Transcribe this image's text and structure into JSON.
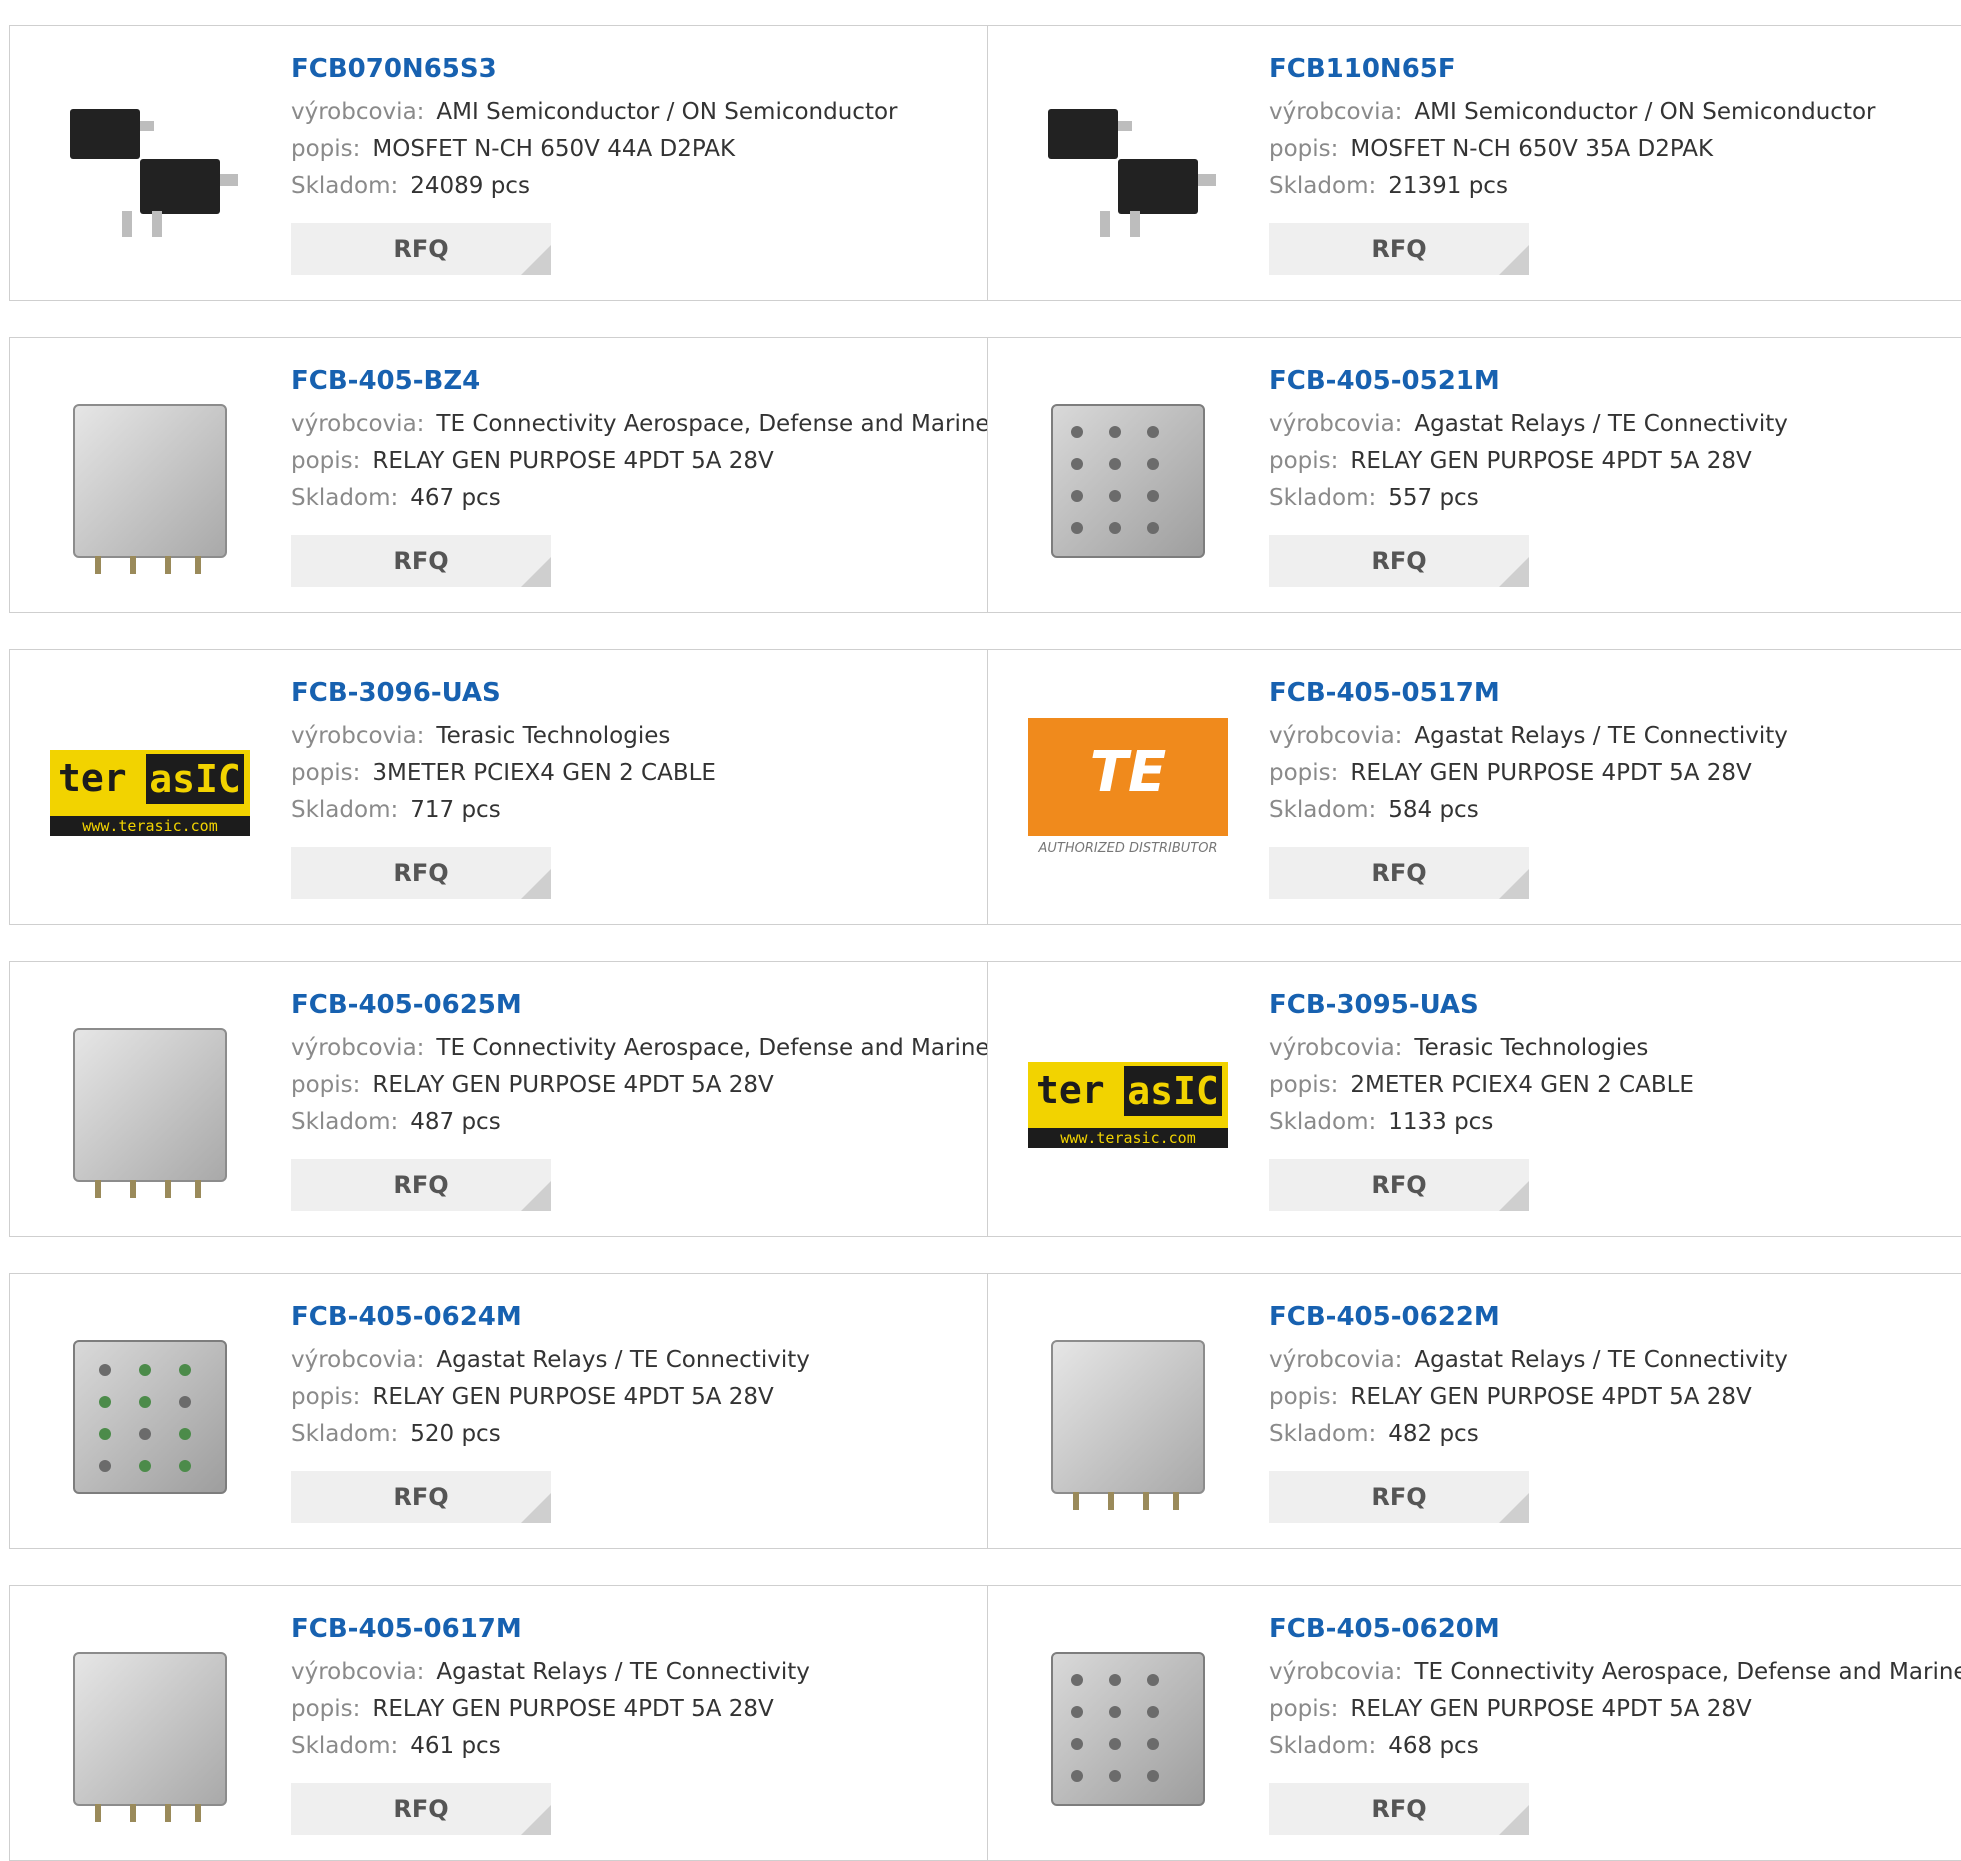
{
  "labels": {
    "manufacturer": "výrobcovia:",
    "description": "popis:",
    "stock": "Skladom:",
    "rfq": "RFQ"
  },
  "colors": {
    "title": "#1761b0",
    "label": "#8a8a8a",
    "value": "#333333",
    "border": "#cfcfcf",
    "rfq_bg": "#efefef"
  },
  "products": [
    {
      "part": "FCB070N65S3",
      "manufacturer": "AMI Semiconductor / ON Semiconductor",
      "description": "MOSFET N-CH 650V 44A D2PAK",
      "stock": "24089 pcs",
      "icon": "mosfet-d2pak-icon"
    },
    {
      "part": "FCB110N65F",
      "manufacturer": "AMI Semiconductor / ON Semiconductor",
      "description": "MOSFET N-CH 650V 35A D2PAK",
      "stock": "21391 pcs",
      "icon": "mosfet-d2pak-icon"
    },
    {
      "part": "FCB-405-BZ4",
      "manufacturer": "TE Connectivity Aerospace, Defense and Marine",
      "description": "RELAY GEN PURPOSE 4PDT 5A 28V",
      "stock": "467 pcs",
      "icon": "relay-icon"
    },
    {
      "part": "FCB-405-0521M",
      "manufacturer": "Agastat Relays / TE Connectivity",
      "description": "RELAY GEN PURPOSE 4PDT 5A 28V",
      "stock": "557 pcs",
      "icon": "relay-pins-icon"
    },
    {
      "part": "FCB-3096-UAS",
      "manufacturer": "Terasic Technologies",
      "description": "3METER PCIEX4 GEN 2 CABLE",
      "stock": "717 pcs",
      "icon": "terasic-logo"
    },
    {
      "part": "FCB-405-0517M",
      "manufacturer": "Agastat Relays / TE Connectivity",
      "description": "RELAY GEN PURPOSE 4PDT 5A 28V",
      "stock": "584 pcs",
      "icon": "te-connectivity-logo"
    },
    {
      "part": "FCB-405-0625M",
      "manufacturer": "TE Connectivity Aerospace, Defense and Marine",
      "description": "RELAY GEN PURPOSE 4PDT 5A 28V",
      "stock": "487 pcs",
      "icon": "relay-icon"
    },
    {
      "part": "FCB-3095-UAS",
      "manufacturer": "Terasic Technologies",
      "description": "2METER PCIEX4 GEN 2 CABLE",
      "stock": "1133 pcs",
      "icon": "terasic-logo"
    },
    {
      "part": "FCB-405-0624M",
      "manufacturer": "Agastat Relays / TE Connectivity",
      "description": "RELAY GEN PURPOSE 4PDT 5A 28V",
      "stock": "520 pcs",
      "icon": "relay-front-icon"
    },
    {
      "part": "FCB-405-0622M",
      "manufacturer": "Agastat Relays / TE Connectivity",
      "description": "RELAY GEN PURPOSE 4PDT 5A 28V",
      "stock": "482 pcs",
      "icon": "relay-icon"
    },
    {
      "part": "FCB-405-0617M",
      "manufacturer": "Agastat Relays / TE Connectivity",
      "description": "RELAY GEN PURPOSE 4PDT 5A 28V",
      "stock": "461 pcs",
      "icon": "relay-icon"
    },
    {
      "part": "FCB-405-0620M",
      "manufacturer": "TE Connectivity Aerospace, Defense and Marine",
      "description": "RELAY GEN PURPOSE 4PDT 5A 28V",
      "stock": "468 pcs",
      "icon": "relay-pins-icon"
    }
  ],
  "logos": {
    "terasic_ter": "ter",
    "terasic_asic": "asIC",
    "terasic_url": "www.terasic.com",
    "te_mark": "TE",
    "te_sub": "AUTHORIZED DISTRIBUTOR"
  }
}
